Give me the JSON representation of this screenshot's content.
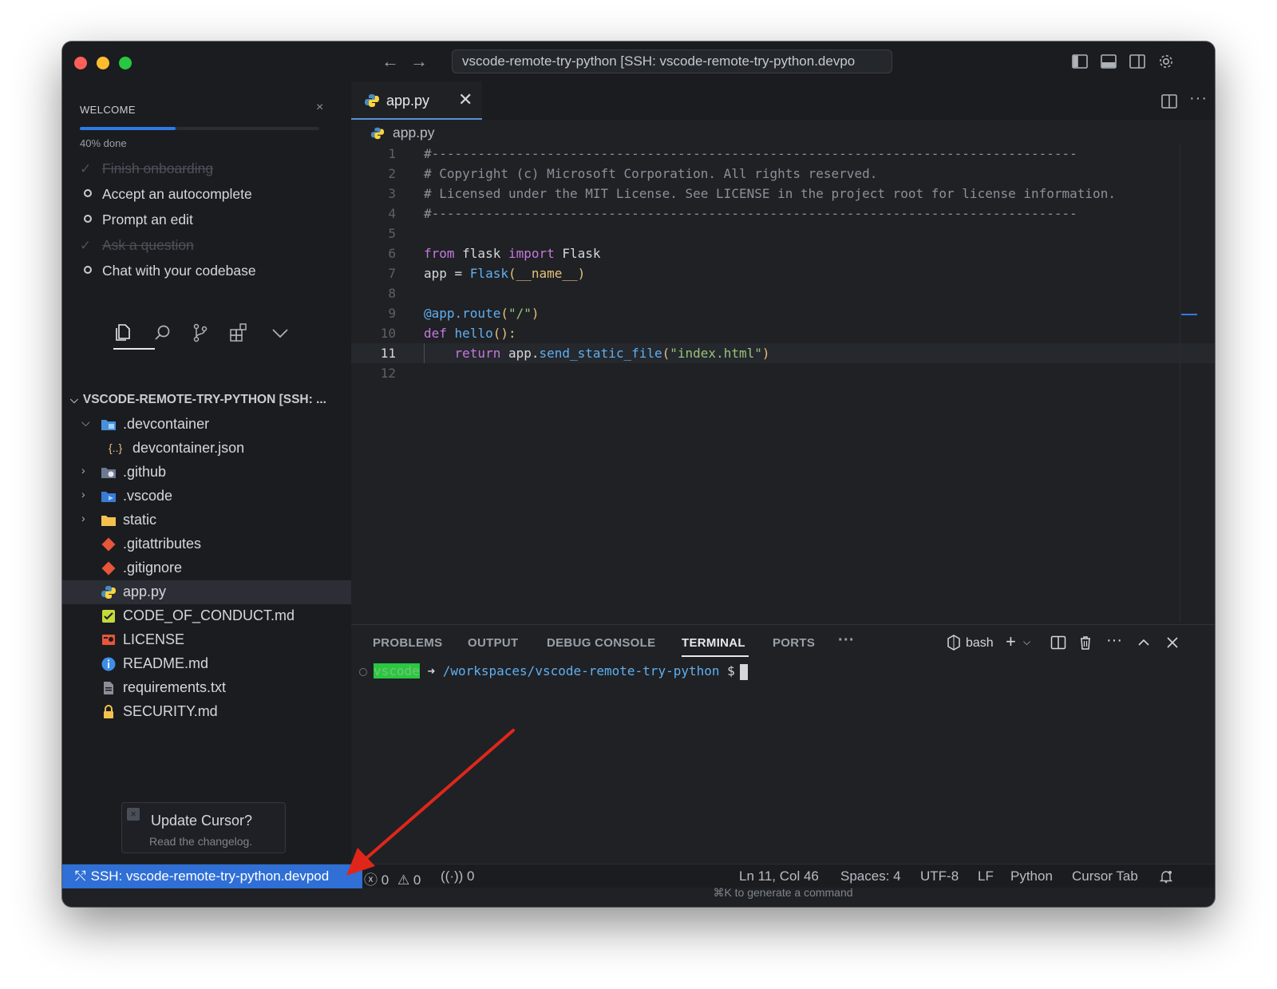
{
  "titlebar": {
    "command_center": "vscode-remote-try-python [SSH: vscode-remote-try-python.devpo",
    "icons": [
      "arrow-left-icon",
      "arrow-right-icon",
      "toggle-primary-sidebar-icon",
      "toggle-panel-icon",
      "toggle-secondary-sidebar-icon",
      "settings-gear-icon"
    ]
  },
  "welcome": {
    "title": "WELCOME",
    "close": "×",
    "progress_label": "40% done",
    "progress_fraction": 0.4,
    "items": [
      {
        "label": "Finish onboarding",
        "done": true
      },
      {
        "label": "Accept an autocomplete",
        "done": false
      },
      {
        "label": "Prompt an edit",
        "done": false
      },
      {
        "label": "Ask a question",
        "done": true
      },
      {
        "label": "Chat with your codebase",
        "done": false
      }
    ]
  },
  "activity": [
    "explorer-icon",
    "search-icon",
    "source-control-icon",
    "extensions-icon",
    "chevron-down-icon"
  ],
  "explorer": {
    "header": "VSCODE-REMOTE-TRY-PYTHON [SSH: ...",
    "tree": [
      {
        "name": ".devcontainer",
        "type": "folder-open"
      },
      {
        "name": "devcontainer.json",
        "type": "json"
      },
      {
        "name": ".github",
        "type": "folder"
      },
      {
        "name": ".vscode",
        "type": "folder"
      },
      {
        "name": "static",
        "type": "folder"
      },
      {
        "name": ".gitattributes",
        "type": "git"
      },
      {
        "name": ".gitignore",
        "type": "git"
      },
      {
        "name": "app.py",
        "type": "python"
      },
      {
        "name": "CODE_OF_CONDUCT.md",
        "type": "md-check"
      },
      {
        "name": "LICENSE",
        "type": "license"
      },
      {
        "name": "README.md",
        "type": "info"
      },
      {
        "name": "requirements.txt",
        "type": "text"
      },
      {
        "name": "SECURITY.md",
        "type": "lock"
      }
    ]
  },
  "toast": {
    "title": "Update Cursor?",
    "subtitle": "Read the changelog.",
    "close": "×"
  },
  "editor": {
    "tab_label": "app.py",
    "tab_close": "✕",
    "breadcrumb": "app.py",
    "lines": [
      {
        "n": "1",
        "segs": [
          {
            "t": "#------------------------------------------------------------------------------------",
            "c": "c-comment"
          }
        ]
      },
      {
        "n": "2",
        "segs": [
          {
            "t": "# Copyright (c) Microsoft Corporation. All rights reserved.",
            "c": "c-comment"
          }
        ]
      },
      {
        "n": "3",
        "segs": [
          {
            "t": "# Licensed under the MIT License. See LICENSE in the project root for license information.",
            "c": "c-comment"
          }
        ]
      },
      {
        "n": "4",
        "segs": [
          {
            "t": "#------------------------------------------------------------------------------------",
            "c": "c-comment"
          }
        ]
      },
      {
        "n": "5",
        "segs": []
      },
      {
        "n": "6",
        "segs": [
          {
            "t": "from",
            "c": "c-kw"
          },
          {
            "t": " flask ",
            "c": ""
          },
          {
            "t": "import",
            "c": "c-kw"
          },
          {
            "t": " Flask",
            "c": ""
          }
        ]
      },
      {
        "n": "7",
        "segs": [
          {
            "t": "app = ",
            "c": ""
          },
          {
            "t": "Flask",
            "c": "c-fn"
          },
          {
            "t": "(",
            "c": "c-name"
          },
          {
            "t": "__name__",
            "c": "c-name"
          },
          {
            "t": ")",
            "c": "c-name"
          }
        ]
      },
      {
        "n": "8",
        "segs": []
      },
      {
        "n": "9",
        "segs": [
          {
            "t": "@app.route",
            "c": "c-fn"
          },
          {
            "t": "(",
            "c": "c-name"
          },
          {
            "t": "\"/\"",
            "c": "c-str"
          },
          {
            "t": ")",
            "c": "c-name"
          }
        ]
      },
      {
        "n": "10",
        "segs": [
          {
            "t": "def",
            "c": "c-kw"
          },
          {
            "t": " ",
            "c": ""
          },
          {
            "t": "hello",
            "c": "c-fn"
          },
          {
            "t": "():",
            "c": "c-name"
          }
        ]
      },
      {
        "n": "11",
        "segs": [
          {
            "t": "    return",
            "c": "c-kw"
          },
          {
            "t": " app.",
            "c": ""
          },
          {
            "t": "send_static_file",
            "c": "c-fn"
          },
          {
            "t": "(",
            "c": "c-name"
          },
          {
            "t": "\"index.html\"",
            "c": "c-str"
          },
          {
            "t": ")",
            "c": "c-name"
          }
        ]
      },
      {
        "n": "12",
        "segs": []
      }
    ]
  },
  "panel": {
    "tabs": [
      "PROBLEMS",
      "OUTPUT",
      "DEBUG CONSOLE",
      "TERMINAL",
      "PORTS"
    ],
    "active_tab": "TERMINAL",
    "more": "···",
    "shell": "bash",
    "prompt_user": "vscode",
    "prompt_arrow": "➜",
    "prompt_path": "/workspaces/vscode-remote-try-python",
    "prompt_symbol": "$",
    "hint": "⌘K to generate a command"
  },
  "statusbar": {
    "remote": "SSH: vscode-remote-try-python.devpod",
    "errors": "0",
    "warnings": "0",
    "ports": "0",
    "position": "Ln 11, Col 46",
    "spaces": "Spaces: 4",
    "encoding": "UTF-8",
    "eol": "LF",
    "language": "Python",
    "cursor_tab": "Cursor Tab"
  },
  "colors": {
    "accent": "#2f6fd6",
    "annotation_arrow": "#e0261b"
  }
}
